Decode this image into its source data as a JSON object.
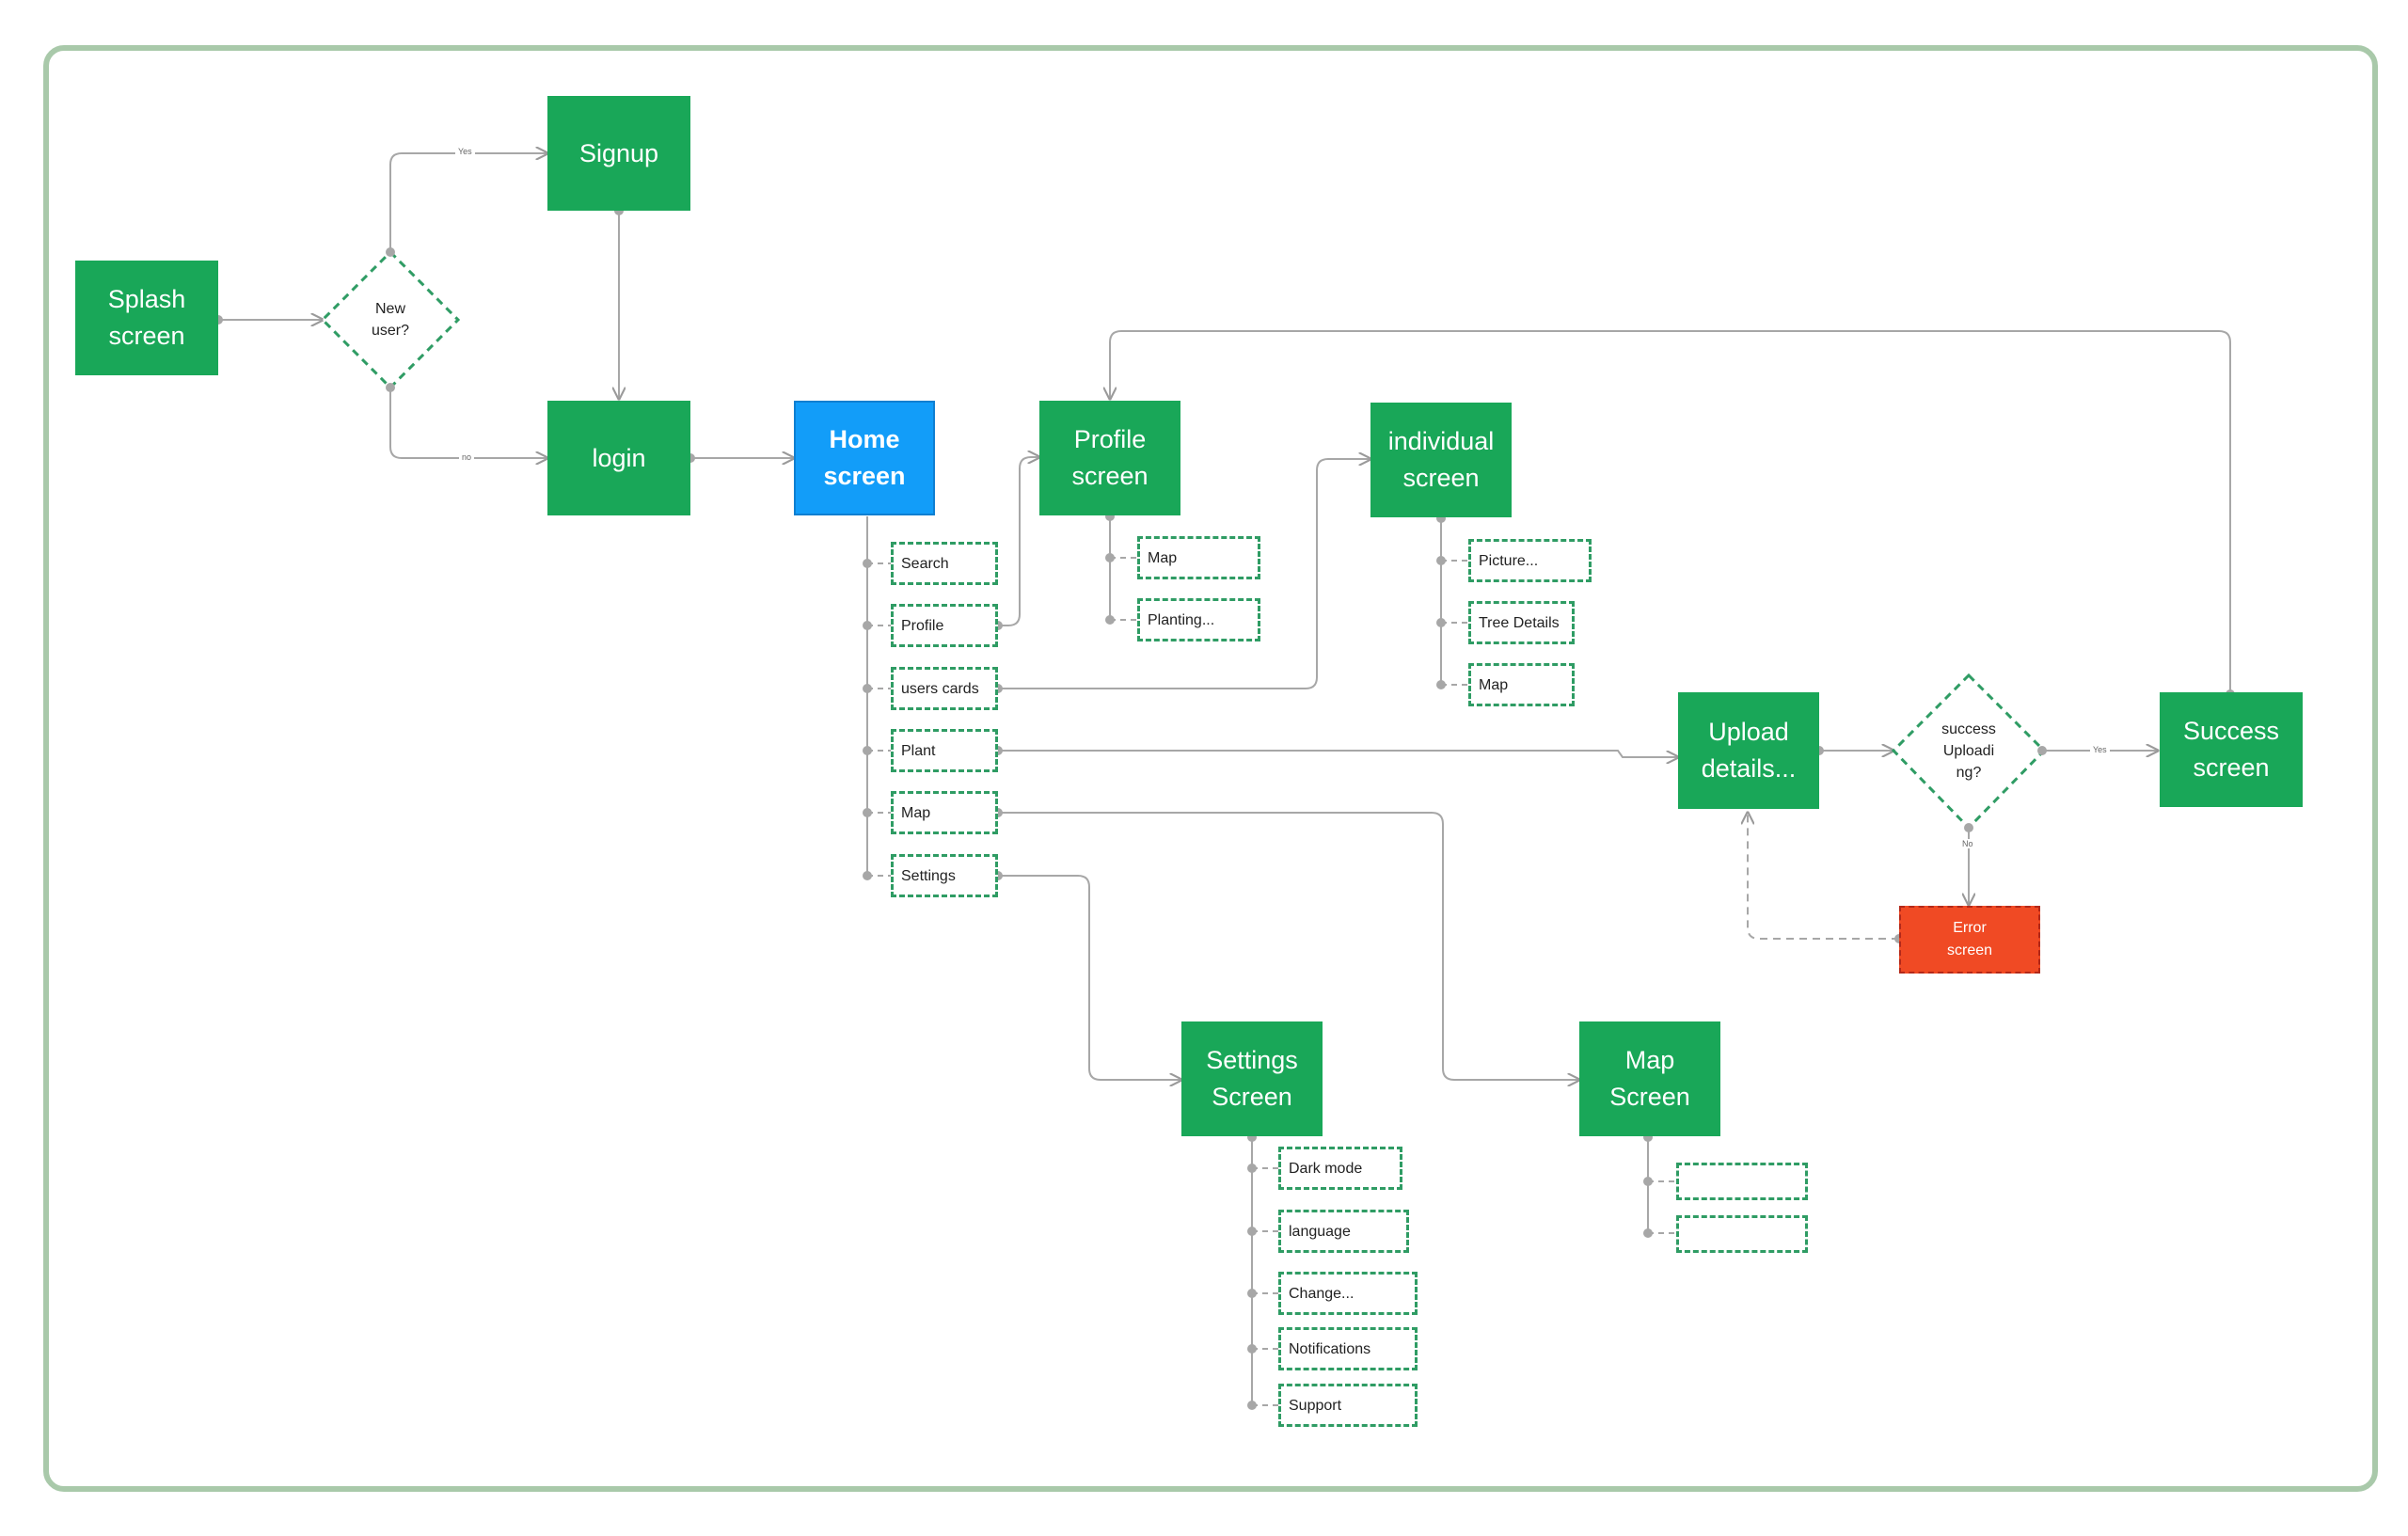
{
  "nodes": {
    "splash": "Splash\nscreen",
    "signup": "Signup",
    "login": "login",
    "home": "Home\nscreen",
    "profile": "Profile\nscreen",
    "individual": "individual\nscreen",
    "upload": "Upload\ndetails...",
    "success": "Success\nscreen",
    "error": "Error\nscreen",
    "settings": "Settings\nScreen",
    "map": "Map\nScreen"
  },
  "decisions": {
    "new_user": "New\nuser?",
    "success_uploading": "success\nUploadi\nng?"
  },
  "edge_labels": {
    "yes_signup": "Yes",
    "no_login": "no",
    "yes_success": "Yes",
    "no_error": "No"
  },
  "home_items": [
    "Search",
    "Profile",
    "users cards",
    "Plant",
    "Map",
    "Settings"
  ],
  "profile_items": [
    "Map",
    "Planting..."
  ],
  "individual_items": [
    "Picture...",
    "Tree Details",
    "Map"
  ],
  "settings_items": [
    "Dark mode",
    "language",
    "Change...",
    "Notifications",
    "Support"
  ],
  "map_items": [
    "",
    ""
  ],
  "colors": {
    "screen": "#19a758",
    "home": "#129df9",
    "error": "#f04a24",
    "frame": "#a9c9aa",
    "connector": "#a7a7a7"
  }
}
